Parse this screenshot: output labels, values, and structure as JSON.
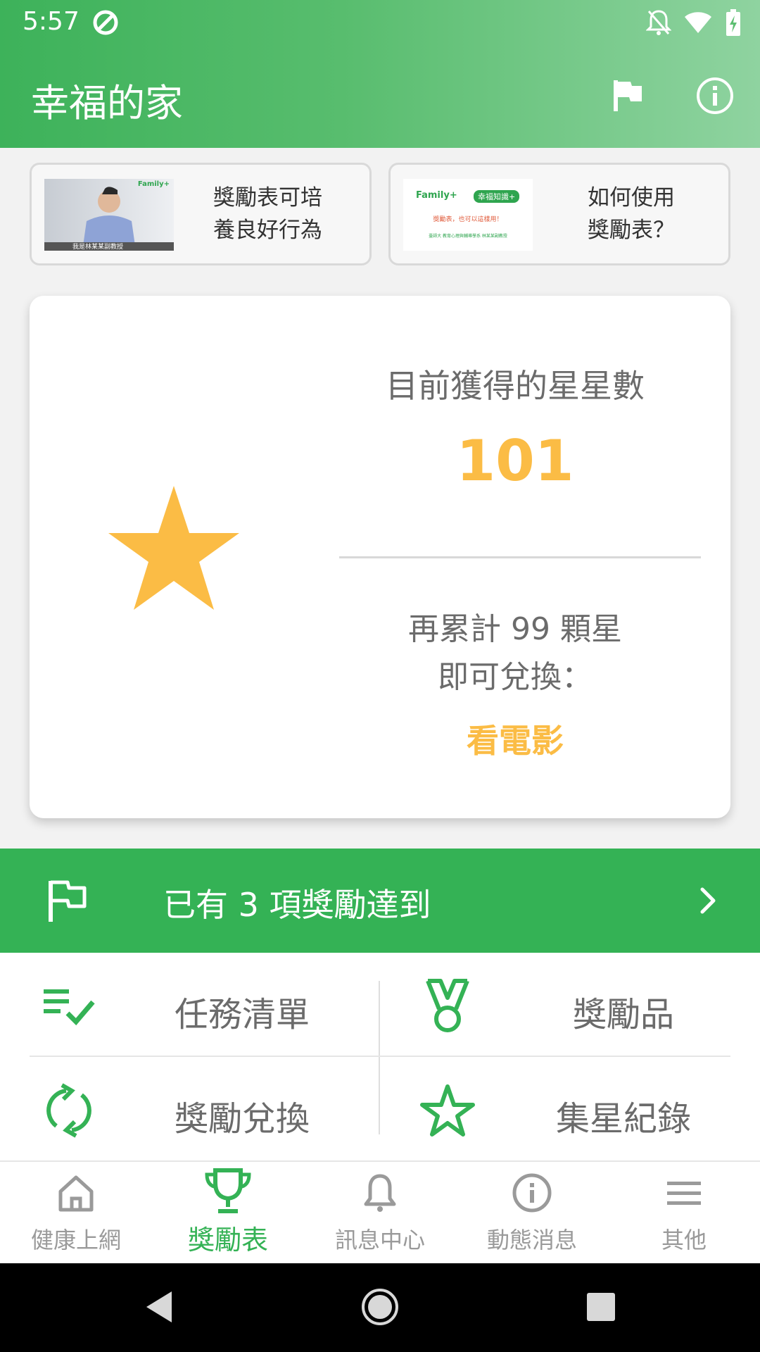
{
  "colors": {
    "primary_green": "#34b255",
    "star_yellow": "#fbbc45",
    "text_gray": "#6b6b6b"
  },
  "status_bar": {
    "time": "5:57",
    "icons": [
      "app-notification-icon",
      "bell-off-icon",
      "wifi-icon",
      "battery-charging-icon"
    ]
  },
  "app_bar": {
    "title": "幸福的家",
    "actions": [
      "flag-icon",
      "info-icon"
    ]
  },
  "articles": [
    {
      "thumb_brand": "Family+",
      "thumb_caption": "我是林某某副教授",
      "title_line1": "獎勵表可培",
      "title_line2": "養良好行為"
    },
    {
      "thumb_brand": "Family+",
      "thumb_badge": "幸福知識+",
      "thumb_line1": "獎勵表，也可以這樣用！",
      "thumb_line2": "臺師大 教育心理與輔導學系 林某某副教授",
      "title_line1": "如何使用",
      "title_line2": "獎勵表？"
    }
  ],
  "star_card": {
    "label": "目前獲得的星星數",
    "count": "101",
    "remaining_line1": "再累計 99 顆星",
    "remaining_line2": "即可兌換：",
    "reward": "看電影"
  },
  "achieved_banner": {
    "text": "已有 3 項獎勵達到"
  },
  "menu": [
    {
      "label": "任務清單",
      "icon": "checklist-icon"
    },
    {
      "label": "獎勵品",
      "icon": "medal-icon"
    },
    {
      "label": "獎勵兌換",
      "icon": "exchange-icon"
    },
    {
      "label": "集星紀錄",
      "icon": "star-outline-icon"
    }
  ],
  "bottom_nav": [
    {
      "label": "健康上網",
      "icon": "home-icon",
      "active": false
    },
    {
      "label": "獎勵表",
      "icon": "trophy-icon",
      "active": true
    },
    {
      "label": "訊息中心",
      "icon": "bell-icon",
      "active": false
    },
    {
      "label": "動態消息",
      "icon": "info-circle-icon",
      "active": false
    },
    {
      "label": "其他",
      "icon": "menu-icon",
      "active": false
    }
  ],
  "system_nav": [
    "back-icon",
    "home-circle-icon",
    "recents-icon"
  ]
}
